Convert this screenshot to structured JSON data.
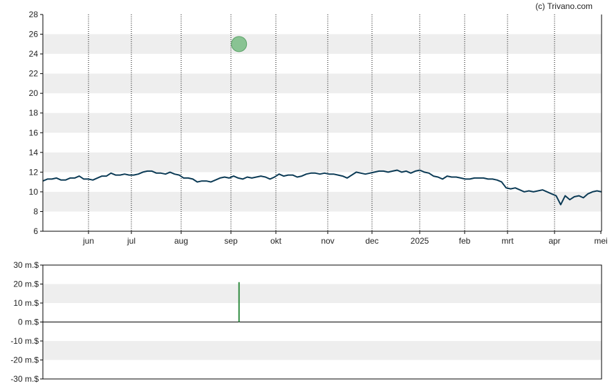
{
  "credit": "(c) Trivano.com",
  "colors": {
    "price_line": "#0b3a55",
    "marker_fill": "#7fbf8a",
    "marker_stroke": "#4c9a5a",
    "volume_bar": "#2e8b3e",
    "band": "#eeeeee",
    "axis": "#000000",
    "vgrid": "#000000"
  },
  "chart_data": [
    {
      "type": "line",
      "name": "price",
      "x_tick_labels": [
        "jun",
        "jul",
        "aug",
        "sep",
        "okt",
        "nov",
        "dec",
        "2025",
        "feb",
        "mrt",
        "apr",
        "mei"
      ],
      "y_tick_labels": [
        "6",
        "8",
        "10",
        "12",
        "14",
        "16",
        "18",
        "20",
        "22",
        "24",
        "26",
        "28"
      ],
      "ylim": [
        6,
        28
      ],
      "grid": "alternating horizontal bands, dotted vertical lines at month ticks",
      "series": [
        {
          "values": [
            11.1,
            11.3,
            11.3,
            11.4,
            11.2,
            11.2,
            11.4,
            11.4,
            11.6,
            11.3,
            11.3,
            11.2,
            11.4,
            11.6,
            11.6,
            11.9,
            11.7,
            11.7,
            11.8,
            11.7,
            11.7,
            11.8,
            12.0,
            12.1,
            12.1,
            11.9,
            11.9,
            11.8,
            12.0,
            11.8,
            11.7,
            11.4,
            11.4,
            11.3,
            11.0,
            11.1,
            11.1,
            11.0,
            11.2,
            11.4,
            11.5,
            11.4,
            11.6,
            11.4,
            11.3,
            11.5,
            11.4,
            11.5,
            11.6,
            11.5,
            11.3,
            11.5,
            11.8,
            11.6,
            11.7,
            11.7,
            11.5,
            11.6,
            11.8,
            11.9,
            11.9,
            11.8,
            11.9,
            11.8,
            11.8,
            11.7,
            11.6,
            11.4,
            11.7,
            12.0,
            11.9,
            11.8,
            11.9,
            12.0,
            12.1,
            12.1,
            12.0,
            12.1,
            12.2,
            12.0,
            12.1,
            11.9,
            12.1,
            12.2,
            12.0,
            11.9,
            11.6,
            11.5,
            11.3,
            11.6,
            11.5,
            11.5,
            11.4,
            11.3,
            11.3,
            11.4,
            11.4,
            11.4,
            11.3,
            11.3,
            11.2,
            11.0,
            10.4,
            10.3,
            10.4,
            10.2,
            10.0,
            10.1,
            10.0,
            10.1,
            10.2,
            10.0,
            9.8,
            9.6,
            8.7,
            9.6,
            9.2,
            9.5,
            9.6,
            9.4,
            9.8,
            10.0,
            10.1,
            10.0
          ]
        }
      ],
      "annotations": [
        {
          "label": "",
          "x_month_offset": 3.18,
          "y": 25.0
        }
      ]
    },
    {
      "type": "bar",
      "name": "volume",
      "y_tick_labels": [
        "30 m.$",
        "20 m.$",
        "10 m.$",
        "0 m.$",
        "-10 m.$",
        "-20 m.$",
        "-30 m.$"
      ],
      "ylim": [
        -30,
        30
      ],
      "bars": [
        {
          "x_month_offset": 3.18,
          "value": 21
        }
      ]
    }
  ]
}
